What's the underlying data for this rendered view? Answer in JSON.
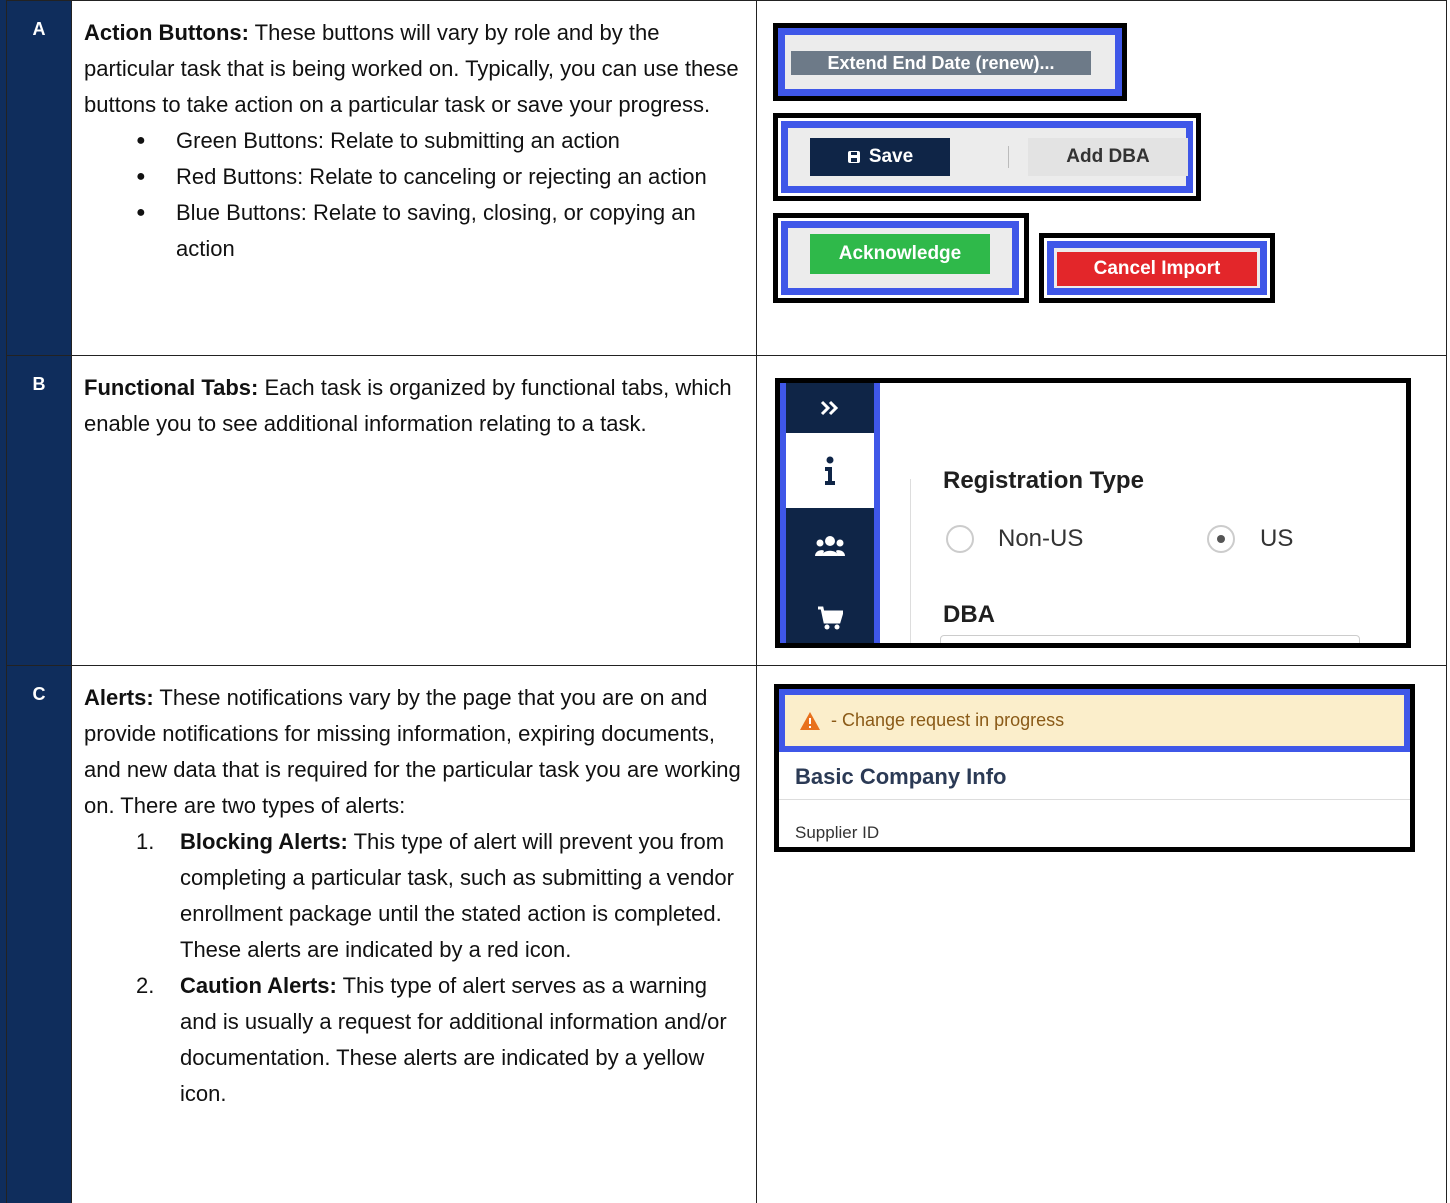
{
  "rows": [
    {
      "letter": "A",
      "title": "Action Buttons:",
      "body": " These buttons will vary by role and by the particular task that is being worked on. Typically, you can use these buttons to take action on a particular task or save your progress.",
      "bullets": [
        "Green Buttons: Relate to submitting an action",
        "Red Buttons: Relate to canceling or rejecting an action",
        "Blue Buttons: Relate to saving, closing, or copying an action"
      ],
      "demo": {
        "extend_button": "Extend End Date (renew)...",
        "save_button": "Save",
        "add_dba_button": "Add DBA",
        "acknowledge_button": "Acknowledge",
        "cancel_import_button": "Cancel Import"
      }
    },
    {
      "letter": "B",
      "title": "Functional Tabs:",
      "body": " Each task is organized by functional tabs, which enable you to see additional information relating to a task.",
      "demo": {
        "registration_type": "Registration Type",
        "option_non_us": "Non-US",
        "option_us": "US",
        "dba_label": "DBA"
      }
    },
    {
      "letter": "C",
      "title": "Alerts:",
      "body": " These notifications vary by the page that you are on and provide notifications for missing information, expiring documents, and new data that is required for the particular task you are working on. There are two types of alerts:",
      "items": [
        {
          "num": "1.",
          "title": "Blocking Alerts:",
          "body": " This type of alert will prevent you from completing a particular task, such as submitting a vendor enrollment package until the stated action is completed. These alerts are indicated by a red icon."
        },
        {
          "num": "2.",
          "title": "Caution Alerts:",
          "body": " This type of alert serves as a warning and is usually a request for additional information and/or documentation. These alerts are indicated by a yellow icon."
        }
      ],
      "demo": {
        "alert_text": "- Change request in progress",
        "section_title": "Basic Company Info",
        "supplier_label": "Supplier ID"
      }
    }
  ],
  "colors": {
    "navy": "#0f2d5c",
    "highlight_blue": "#3f57e8",
    "green": "#2fb94a",
    "red": "#e3262a",
    "alert_bg": "#fbeecb"
  }
}
